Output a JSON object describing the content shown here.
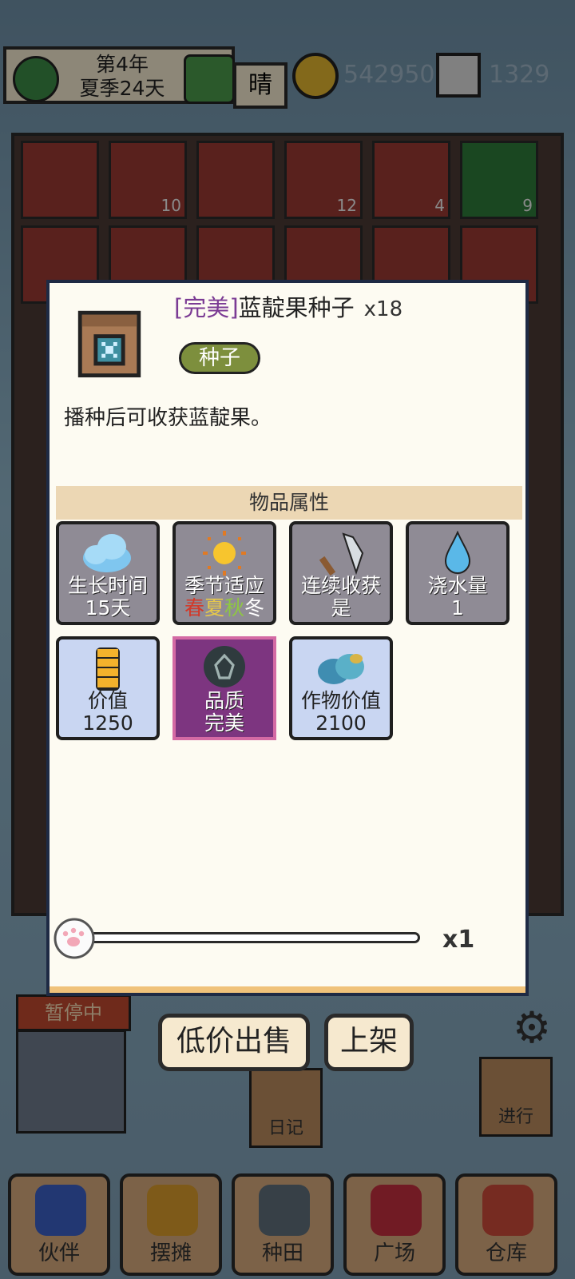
{
  "topbar": {
    "date_line1": "第4年",
    "date_line2": "夏季24天",
    "weather": "晴",
    "coins": "542950",
    "gems": "1329"
  },
  "inventory": {
    "counts_row1": [
      "",
      "10",
      "",
      "12",
      "4",
      "9"
    ]
  },
  "status": {
    "pause_label": "暂停中"
  },
  "side_buttons": {
    "diary": "日记",
    "proceed": "进行"
  },
  "nav": [
    {
      "label": "伙伴",
      "icon": "partner-icon"
    },
    {
      "label": "摆摊",
      "icon": "stall-icon"
    },
    {
      "label": "种田",
      "icon": "farming-icon"
    },
    {
      "label": "广场",
      "icon": "plaza-icon"
    },
    {
      "label": "仓库",
      "icon": "warehouse-icon"
    }
  ],
  "item": {
    "quality": "[完美]",
    "name": "蓝靛果种子",
    "count": "x18",
    "tag": "种子",
    "description": "播种后可收获蓝靛果。",
    "icon": "seed-bag-icon"
  },
  "attributes": {
    "header": "物品属性",
    "grow_time": {
      "label": "生长时间",
      "value": "15天",
      "icon": "cloud-icon"
    },
    "season": {
      "label": "季节适应",
      "icon": "sun-icon",
      "seasons": [
        {
          "text": "春",
          "color": "#d23a2a"
        },
        {
          "text": "夏",
          "color": "#e6c84a"
        },
        {
          "text": "秋",
          "color": "#8fc742"
        },
        {
          "text": "冬",
          "color": "#ffffff"
        }
      ]
    },
    "repeat": {
      "label": "连续收获",
      "value": "是",
      "icon": "sickle-icon"
    },
    "water": {
      "label": "浇水量",
      "value": "1",
      "icon": "water-drop-icon"
    },
    "price": {
      "label": "价值",
      "value": "1250",
      "icon": "coin-stack-icon"
    },
    "quality": {
      "label": "品质",
      "value": "完美",
      "icon": "quality-gem-icon"
    },
    "crop_value": {
      "label": "作物价值",
      "value": "2100",
      "icon": "berry-icon"
    }
  },
  "quantity": {
    "value": "x1",
    "fraction": 0
  },
  "actions": {
    "sell_low": "低价出售",
    "list": "上架"
  },
  "colors": {
    "modal_bg": "#fdfbf2",
    "modal_border": "#1e2a44",
    "tag_green": "#7d8f3d",
    "quality_purple": "#7b3b94"
  }
}
